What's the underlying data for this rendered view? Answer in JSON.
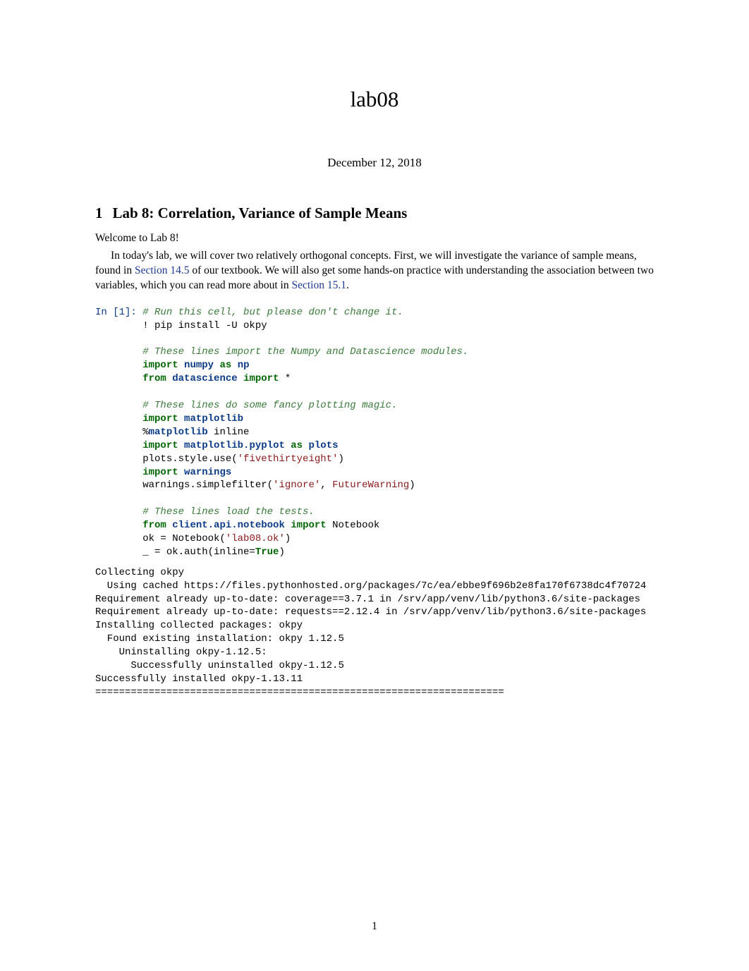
{
  "title": "lab08",
  "date": "December 12, 2018",
  "section": {
    "num": "1",
    "heading": "Lab 8: Correlation, Variance of Sample Means"
  },
  "paragraphs": {
    "p1": "Welcome to Lab 8!",
    "p2_a": "In today's lab, we will cover two relatively orthogonal concepts. First, we will investigate the variance of sample means, found in ",
    "p2_link1": "Section 14.5",
    "p2_b": " of our textbook. We will also get some hands-on practice with understanding the association between two variables, which you can read more about in ",
    "p2_link2": "Section 15.1",
    "p2_c": "."
  },
  "code": {
    "in_label": "In [1]: ",
    "c1": "# Run this cell, but please don't change it.",
    "l2a": "        ! pip install -U okpy",
    "c2": "# These lines import the Numpy and Datascience modules.",
    "l4_import": "import",
    "l4_mod": "numpy",
    "l4_as": "as",
    "l4_alias": "np",
    "l5_from": "from",
    "l5_mod": "datascience",
    "l5_import": "import",
    "l5_star": " *",
    "c3": "# These lines do some fancy plotting magic.",
    "l7_import": "import",
    "l7_mod": "matplotlib",
    "l8_pct": "        %",
    "l8_mod": "matplotlib",
    "l8_rest": " inline",
    "l9_import": "import",
    "l9_mod": "matplotlib.pyplot",
    "l9_as": "as",
    "l9_alias": "plots",
    "l10": "        plots.style.use(",
    "l10_str": "'fivethirtyeight'",
    "l10_end": ")",
    "l11_import": "import",
    "l11_mod": "warnings",
    "l12": "        warnings.simplefilter(",
    "l12_str": "'ignore'",
    "l12_mid": ", ",
    "l12_err": "FutureWarning",
    "l12_end": ")",
    "c4": "# These lines load the tests.",
    "l14_from": "from",
    "l14_mod": "client.api.notebook",
    "l14_import": "import",
    "l14_rest": " Notebook",
    "l15": "        ok = Notebook(",
    "l15_str": "'lab08.ok'",
    "l15_end": ")",
    "l16": "        _ = ok.auth(inline=",
    "l16_bool": "True",
    "l16_end": ")"
  },
  "output": {
    "o1": "Collecting okpy",
    "o2": "  Using cached https://files.pythonhosted.org/packages/7c/ea/ebbe9f696b2e8fa170f6738dc4f70724",
    "o3": "Requirement already up-to-date: coverage==3.7.1 in /srv/app/venv/lib/python3.6/site-packages",
    "o4": "Requirement already up-to-date: requests==2.12.4 in /srv/app/venv/lib/python3.6/site-packages",
    "o5": "Installing collected packages: okpy",
    "o6": "  Found existing installation: okpy 1.12.5",
    "o7": "    Uninstalling okpy-1.12.5:",
    "o8": "      Successfully uninstalled okpy-1.12.5",
    "o9": "Successfully installed okpy-1.13.11",
    "o10": "====================================================================="
  },
  "page_number": "1"
}
